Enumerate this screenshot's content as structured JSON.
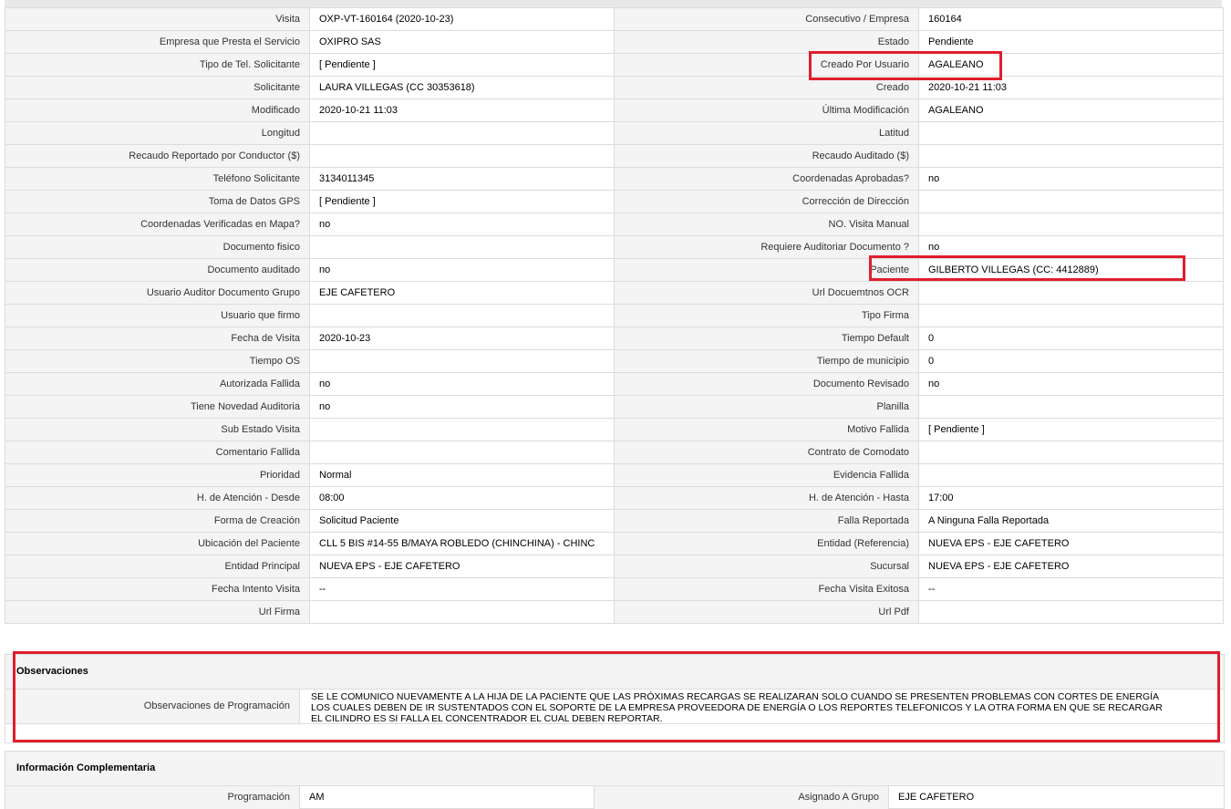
{
  "rows": [
    {
      "l1": "Visita",
      "v1": "OXP-VT-160164 (2020-10-23)",
      "l2": "Consecutivo / Empresa",
      "v2": "160164"
    },
    {
      "l1": "Empresa que Presta el Servicio",
      "v1": "OXIPRO SAS",
      "l2": "Estado",
      "v2": "Pendiente"
    },
    {
      "l1": "Tipo de Tel. Solicitante",
      "v1": "[ Pendiente ]",
      "l2": "Creado Por Usuario",
      "v2": "AGALEANO"
    },
    {
      "l1": "Solicitante",
      "v1": "LAURA VILLEGAS (CC 30353618)",
      "l2": "Creado",
      "v2": "2020-10-21 11:03"
    },
    {
      "l1": "Modificado",
      "v1": "2020-10-21 11:03",
      "l2": "Última Modificación",
      "v2": "AGALEANO"
    },
    {
      "l1": "Longitud",
      "v1": "",
      "l2": "Latitud",
      "v2": ""
    },
    {
      "l1": "Recaudo Reportado por Conductor ($)",
      "v1": "",
      "l2": "Recaudo Auditado ($)",
      "v2": ""
    },
    {
      "l1": "Teléfono Solicitante",
      "v1": "3134011345",
      "l2": "Coordenadas Aprobadas?",
      "v2": "no"
    },
    {
      "l1": "Toma de Datos GPS",
      "v1": "[ Pendiente ]",
      "l2": "Corrección de Dirección",
      "v2": ""
    },
    {
      "l1": "Coordenadas Verificadas en Mapa?",
      "v1": "no",
      "l2": "NO. Visita Manual",
      "v2": ""
    },
    {
      "l1": "Documento fisico",
      "v1": "",
      "l2": "Requiere Auditoriar Documento ?",
      "v2": "no"
    },
    {
      "l1": "Documento auditado",
      "v1": "no",
      "l2": "Paciente",
      "v2": "GILBERTO VILLEGAS (CC: 4412889)"
    },
    {
      "l1": "Usuario Auditor Documento Grupo",
      "v1": "EJE CAFETERO",
      "l2": "Url Docuemtnos OCR",
      "v2": ""
    },
    {
      "l1": "Usuario que firmo",
      "v1": "",
      "l2": "Tipo Firma",
      "v2": ""
    },
    {
      "l1": "Fecha de Visita",
      "v1": "2020-10-23",
      "l2": "Tiempo Default",
      "v2": "0"
    },
    {
      "l1": "Tiempo OS",
      "v1": "",
      "l2": "Tiempo de municipio",
      "v2": "0"
    },
    {
      "l1": "Autorizada Fallida",
      "v1": "no",
      "l2": "Documento Revisado",
      "v2": "no"
    },
    {
      "l1": "Tiene Novedad Auditoria",
      "v1": "no",
      "l2": "Planilla",
      "v2": ""
    },
    {
      "l1": "Sub Estado Visita",
      "v1": "",
      "l2": "Motivo Fallida",
      "v2": "[ Pendiente ]"
    },
    {
      "l1": "Comentario Fallida",
      "v1": "",
      "l2": "Contrato de Comodato",
      "v2": ""
    },
    {
      "l1": "Prioridad",
      "v1": "Normal",
      "l2": "Evidencia Fallida",
      "v2": ""
    },
    {
      "l1": "H. de Atención - Desde",
      "v1": "08:00",
      "l2": "H. de Atención - Hasta",
      "v2": "17:00"
    },
    {
      "l1": "Forma de Creación",
      "v1": "Solicitud Paciente",
      "l2": "Falla Reportada",
      "v2": "A Ninguna Falla Reportada"
    },
    {
      "l1": "Ubicación del Paciente",
      "v1": "CLL 5 BIS #14-55 B/MAYA ROBLEDO (CHINCHINA) - CHINC",
      "l2": "Entidad (Referencia)",
      "v2": "NUEVA EPS - EJE CAFETERO"
    },
    {
      "l1": "Entidad Principal",
      "v1": "NUEVA EPS - EJE CAFETERO",
      "l2": "Sucursal",
      "v2": "NUEVA EPS - EJE CAFETERO"
    },
    {
      "l1": "Fecha Intento Visita",
      "v1": "--",
      "l2": "Fecha Visita Exitosa",
      "v2": "--"
    },
    {
      "l1": "Url Firma",
      "v1": "",
      "l2": "Url Pdf",
      "v2": ""
    }
  ],
  "observaciones": {
    "title": "Observaciones",
    "label": "Observaciones de Programación",
    "lines": [
      "SE LE COMUNICO NUEVAMENTE A LA HIJA DE LA PACIENTE QUE LAS PRÓXIMAS RECARGAS SE REALIZARAN SOLO CUANDO SE PRESENTEN PROBLEMAS CON CORTES DE ENERGÍA",
      "LOS CUALES DEBEN DE IR SUSTENTADOS CON EL SOPORTE DE LA EMPRESA PROVEEDORA DE ENERGÍA O LOS REPORTES TELEFONICOS Y LA OTRA FORMA EN QUE SE RECARGAR",
      "EL CILINDRO ES SI FALLA EL CONCENTRADOR EL CUAL DEBEN REPORTAR."
    ]
  },
  "complementaria": {
    "title": "Información Complementaria",
    "l1": "Programación",
    "v1": "AM",
    "l2": "Asignado A Grupo",
    "v2": "EJE CAFETERO"
  },
  "colors": {
    "highlight": "#e01e2d",
    "label_bg": "#f4f4f4",
    "border": "#dcdcdc"
  }
}
